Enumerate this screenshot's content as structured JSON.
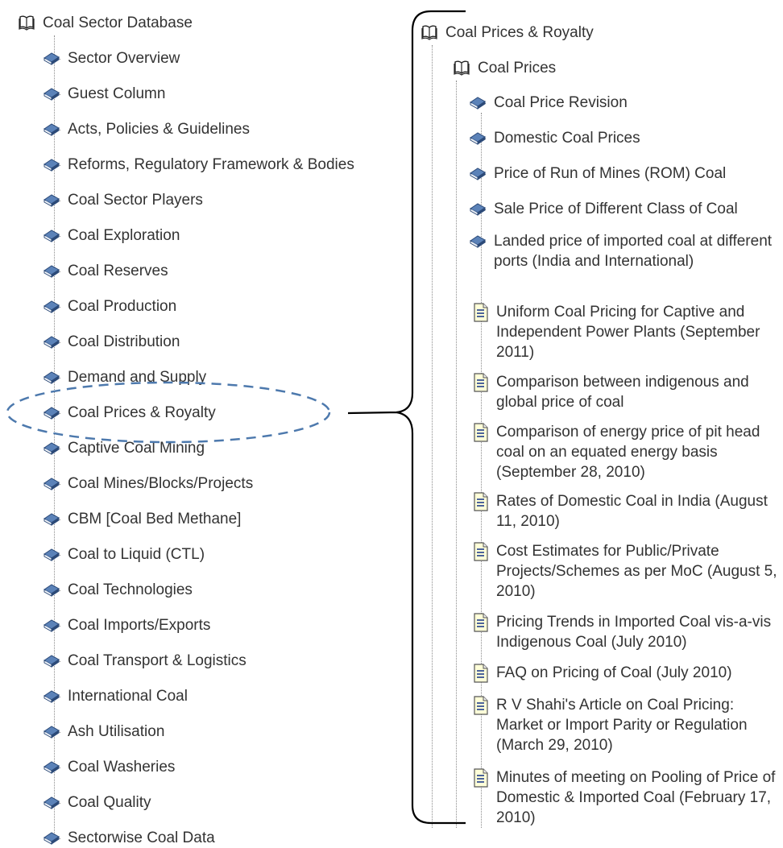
{
  "left_tree": {
    "root": "Coal Sector Database",
    "items": [
      "Sector Overview",
      "Guest Column",
      "Acts, Policies & Guidelines",
      "Reforms, Regulatory Framework & Bodies",
      "Coal Sector Players",
      "Coal Exploration",
      "Coal Reserves",
      "Coal Production",
      "Coal Distribution",
      "Demand and Supply",
      "Coal Prices & Royalty",
      "Captive Coal Mining",
      "Coal Mines/Blocks/Projects",
      "CBM [Coal Bed Methane]",
      "Coal to Liquid (CTL)",
      "Coal Technologies",
      "Coal Imports/Exports",
      "Coal Transport & Logistics",
      "International Coal",
      "Ash Utilisation",
      "Coal Washeries",
      "Coal Quality",
      "Sectorwise Coal Data"
    ]
  },
  "right_tree": {
    "root": "Coal Prices & Royalty",
    "folder": "Coal Prices",
    "items": [
      {
        "label": "Coal Price Revision",
        "icon": "book-icon"
      },
      {
        "label": "Domestic Coal Prices",
        "icon": "book-icon"
      },
      {
        "label": "Price of Run of Mines (ROM) Coal",
        "icon": "book-icon"
      },
      {
        "label": "Sale Price of Different Class of Coal",
        "icon": "book-icon"
      },
      {
        "label": "Landed price of imported coal at different ports (India and International)",
        "icon": "book-icon"
      },
      {
        "label": "Uniform Coal Pricing for Captive and Independent Power Plants (September 2011)",
        "icon": "document-icon"
      },
      {
        "label": "Comparison between indigenous and global price of coal",
        "icon": "document-icon"
      },
      {
        "label": "Comparison of energy price of pit head coal on an equated energy basis (September 28, 2010)",
        "icon": "document-icon"
      },
      {
        "label": "Rates of Domestic Coal in India (August 11, 2010)",
        "icon": "document-icon"
      },
      {
        "label": "Cost Estimates for Public/Private Projects/Schemes as per MoC (August 5, 2010)",
        "icon": "document-icon"
      },
      {
        "label": "Pricing Trends in Imported Coal vis-a-vis Indigenous Coal (July 2010)",
        "icon": "document-icon"
      },
      {
        "label": "FAQ on Pricing of Coal (July 2010)",
        "icon": "document-icon"
      },
      {
        "label": "R V Shahi's Article on Coal Pricing: Market or Import Parity or Regulation (March 29, 2010)",
        "icon": "document-icon"
      },
      {
        "label": "Minutes of meeting on Pooling of Price of Domestic & Imported Coal (February 17, 2010)",
        "icon": "document-icon"
      }
    ]
  },
  "colors": {
    "text": "#333333",
    "book_fill": "#5b82b8",
    "book_dark": "#2c4a78",
    "annotation": "#4d79ad",
    "doc_fill": "#ffffd8",
    "doc_line": "#1f3c8c"
  }
}
